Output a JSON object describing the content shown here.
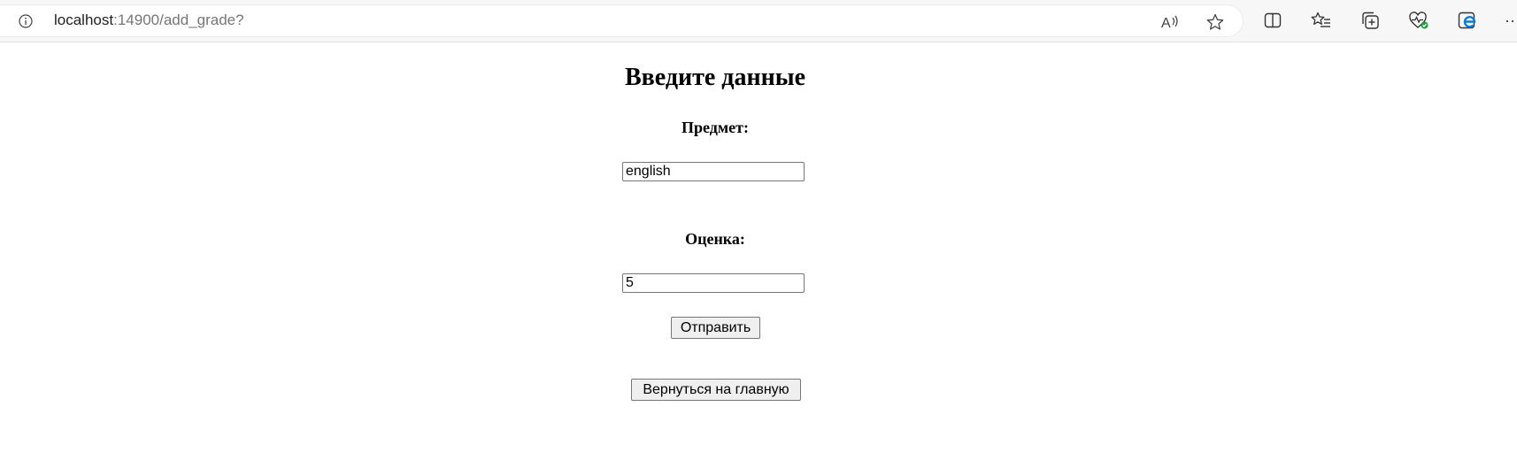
{
  "browser": {
    "url_host": "localhost",
    "url_path": ":14900/add_grade?",
    "icons": [
      "info-icon",
      "read-aloud-icon",
      "favorite-star-icon",
      "split-screen-icon",
      "favorites-list-icon",
      "collections-icon",
      "browser-essentials-icon",
      "edge-copilot-icon",
      "more-icon"
    ],
    "more_label": "···"
  },
  "page": {
    "title": "Введите данные",
    "subject": {
      "label": "Предмет:",
      "value": "english"
    },
    "grade": {
      "label": "Оценка:",
      "value": "5"
    },
    "submit_label": "Отправить",
    "back_label": "Вернуться на главную"
  },
  "colors": {
    "background": "#ffffff",
    "toolbar": "#f7f7f7",
    "button_bg": "#efefef",
    "border": "#767676",
    "edge_accent": "#0a7bd6",
    "health_badge": "#1e9e3a"
  }
}
